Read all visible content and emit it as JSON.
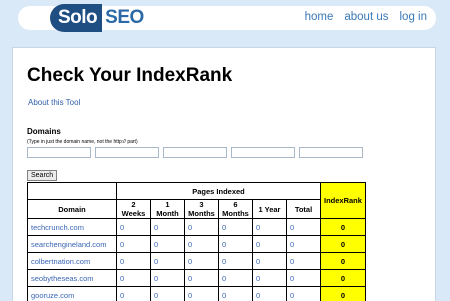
{
  "logo": {
    "part1": "Solo",
    "part2": "SEO"
  },
  "nav": [
    "home",
    "about us",
    "log in"
  ],
  "page": {
    "title": "Check Your IndexRank",
    "about_link": "About this Tool"
  },
  "form": {
    "label": "Domains",
    "hint": "(Type in just the domain name, not the http:// part)",
    "inputs": [
      "",
      "",
      "",
      "",
      ""
    ],
    "search_button": "Search"
  },
  "table": {
    "domain_header": "Domain",
    "group_header": "Pages Indexed",
    "period_headers": [
      "2 Weeks",
      "1 Month",
      "3 Months",
      "6 Months",
      "1 Year",
      "Total"
    ],
    "indexrank_header": "IndexRank",
    "rows": [
      {
        "domain": "techcrunch.com",
        "values": [
          "0",
          "0",
          "0",
          "0",
          "0",
          "0"
        ],
        "indexrank": "0"
      },
      {
        "domain": "searchengineland.com",
        "values": [
          "0",
          "0",
          "0",
          "0",
          "0",
          "0"
        ],
        "indexrank": "0"
      },
      {
        "domain": "colbertnation.com",
        "values": [
          "0",
          "0",
          "0",
          "0",
          "0",
          "0"
        ],
        "indexrank": "0"
      },
      {
        "domain": "seobytheseas.com",
        "values": [
          "0",
          "0",
          "0",
          "0",
          "0",
          "0"
        ],
        "indexrank": "0"
      },
      {
        "domain": "gooruze.com",
        "values": [
          "0",
          "0",
          "0",
          "0",
          "0",
          "0"
        ],
        "indexrank": "0"
      }
    ]
  }
}
